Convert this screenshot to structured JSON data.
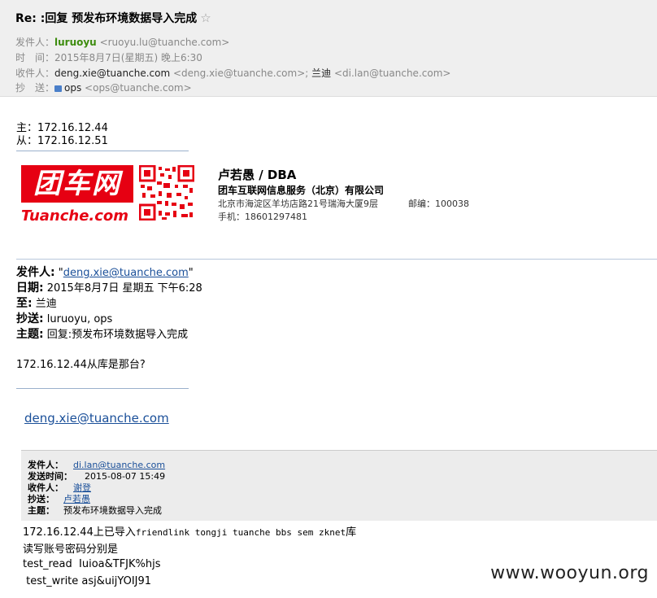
{
  "header": {
    "subject": "Re: :回复 预发布环境数据导入完成",
    "star": "☆",
    "from_label": "发件人：",
    "from_name": "luruoyu",
    "from_email": "<ruoyu.lu@tuanche.com>",
    "time_label": "时　间：",
    "time_value": "2015年8月7日(星期五) 晚上6:30",
    "to_label": "收件人：",
    "to_name1": "deng.xie@tuanche.com",
    "to_email1": "<deng.xie@tuanche.com>;",
    "to_name2": "兰迪",
    "to_email2": "<di.lan@tuanche.com>",
    "cc_label": "抄　送：",
    "cc_name": "ops",
    "cc_email": "<ops@tuanche.com>"
  },
  "body": {
    "master": "主：172.16.12.44",
    "slave": "从：172.16.12.51"
  },
  "signature": {
    "logo_text": "团车网",
    "logo_url": "Tuanche.com",
    "name": "卢若愚 / DBA",
    "company": "团车互联网信息服务（北京）有限公司",
    "address": "北京市海淀区羊坊店路21号瑞海大厦9层",
    "postcode": "邮编：100038",
    "phone": "手机：18601297481"
  },
  "quote1": {
    "from_label": "发件人:",
    "from_q1": " \"",
    "from_link": "deng.xie@tuanche.com",
    "from_q2": "\"",
    "date_label": "日期:",
    "date_value": " 2015年8月7日 星期五 下午6:28",
    "to_label": "至:",
    "to_value": " 兰迪",
    "cc_label": "抄送:",
    "cc_value": " luruoyu, ops",
    "subject_label": "主题:",
    "subject_value": " 回复:预发布环境数据导入完成",
    "body": "172.16.12.44从库是那台?",
    "sig_link": "deng.xie@tuanche.com"
  },
  "quote2": {
    "from_label": "发件人：",
    "from_link": "di.lan@tuanche.com",
    "sent_label": "发送时间：",
    "sent_value": "2015-08-07 15:49",
    "to_label": "收件人：",
    "to_link": "谢登",
    "cc_label": "抄送：",
    "cc_link": "卢若愚",
    "subject_label": "主题：",
    "subject_value": "预发布环境数据导入完成",
    "line1_a": "172.16.12.44上已导入",
    "line1_b": "friendlink  tongji tuanche bbs sem zknet",
    "line1_c": "库",
    "line2": "读写账号密码分别是",
    "line3": "test_read  Iuioa&TFJK%hjs",
    "line4": " test_write asj&uijYOIJ91"
  },
  "watermark": "www.wooyun.org"
}
